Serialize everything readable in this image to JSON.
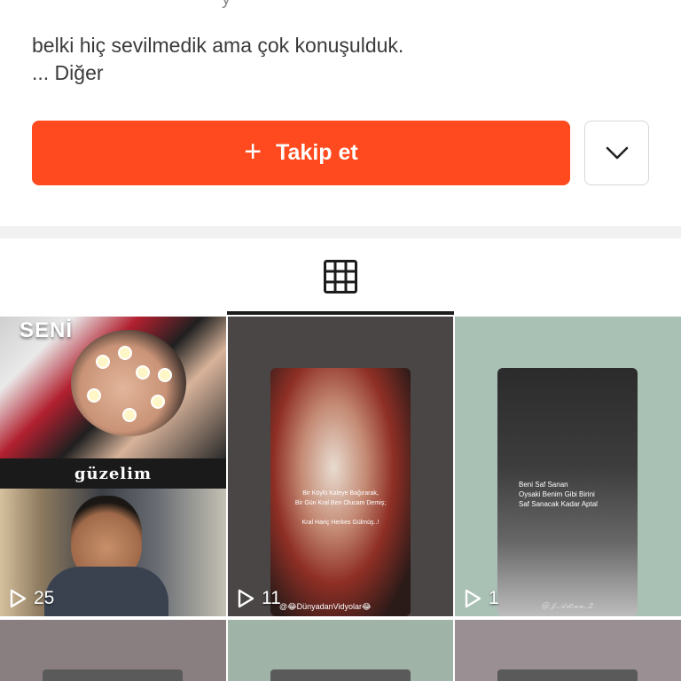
{
  "bio": {
    "text": "belki hiç sevilmedik ama çok konuşulduk.",
    "more": "...  Diğer"
  },
  "actions": {
    "follow_label": "Takip et",
    "follow_color": "#fe4a1e"
  },
  "tabs": {
    "active": "grid"
  },
  "videos": [
    {
      "plays": "25",
      "overlay_top": "SENİ",
      "overlay_mid": "güzelim"
    },
    {
      "plays": "11",
      "lines": [
        "Bir Köylü Kaleye Bağırarak,",
        "Bir Gün Kral Ben Olucam Demiş;",
        "",
        "Kral Hariç Herkes Gülmüş..!"
      ],
      "watermark": "@😂DünyadanVidyolar😂"
    },
    {
      "plays": "1",
      "lines": [
        "Beni Saf Sanan",
        "Oysaki Benim Gibi Birini",
        "Saf Sanacak Kadar Aptal"
      ],
      "watermark": "@𝒥.𝒜𝓇𝑒𝓃𝓃..𝟤"
    }
  ]
}
